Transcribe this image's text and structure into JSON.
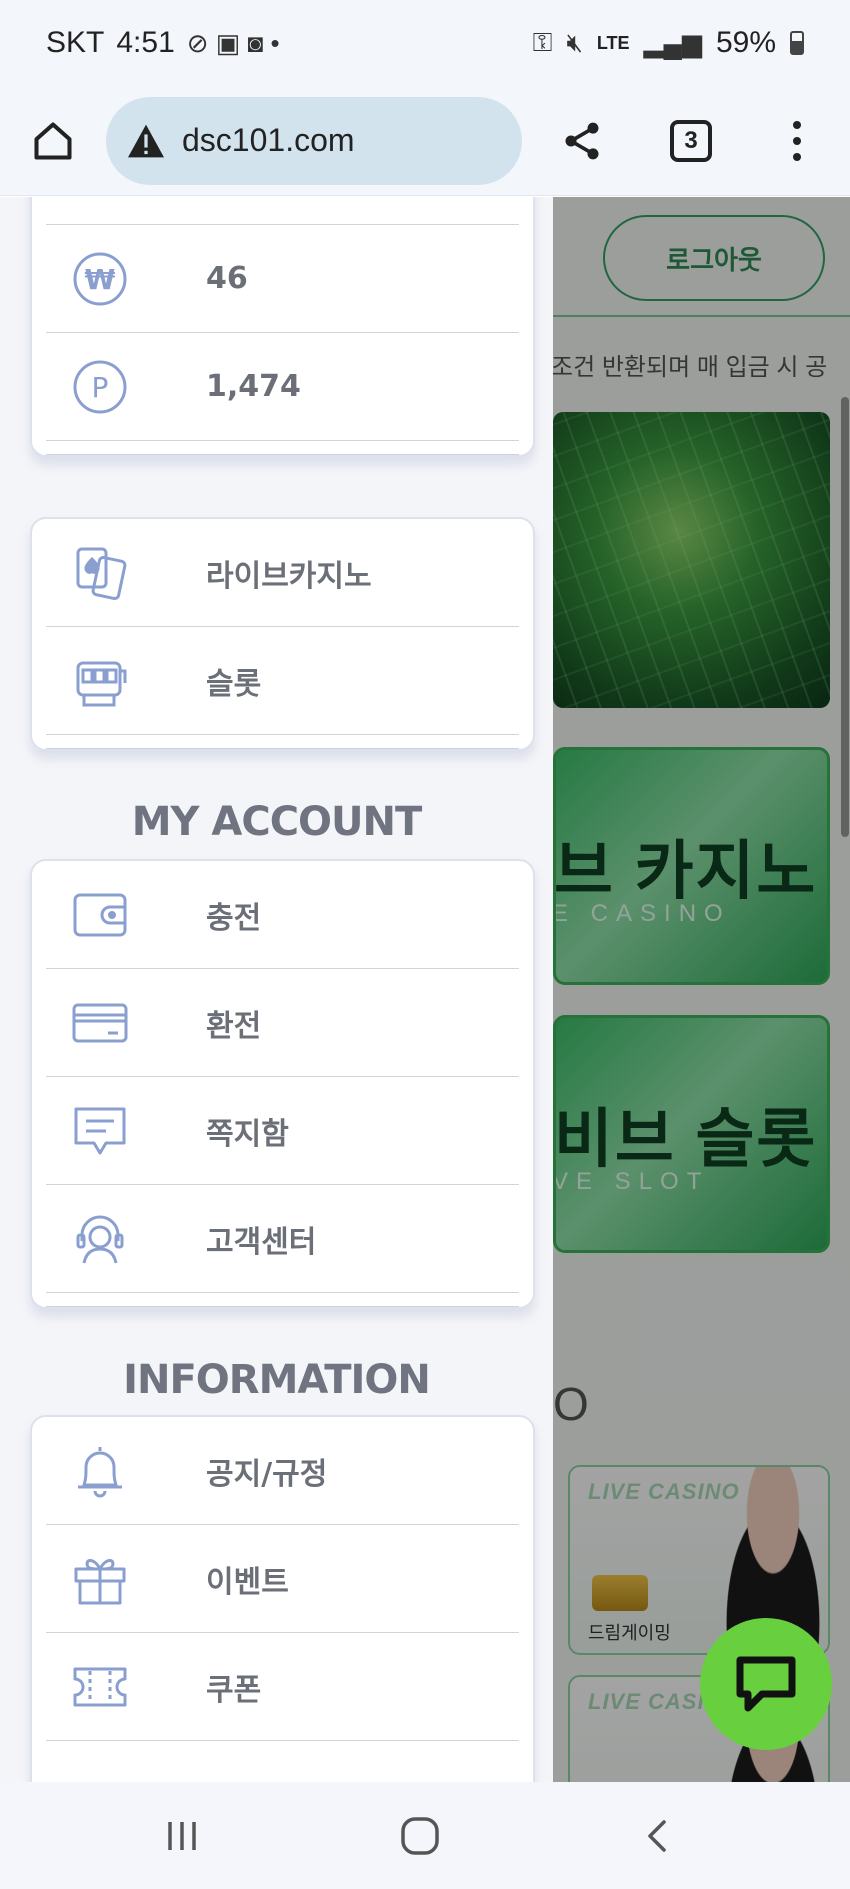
{
  "status_bar": {
    "carrier": "SKT",
    "time": "4:51",
    "network": "LTE",
    "battery": "59%"
  },
  "browser": {
    "url": "dsc101.com",
    "tab_count": "3"
  },
  "drawer": {
    "balance": {
      "cash_symbol": "₩",
      "cash": "46",
      "point_symbol": "P",
      "points": "1,474"
    },
    "games": [
      {
        "label": "라이브카지노",
        "icon": "cards-icon"
      },
      {
        "label": "슬롯",
        "icon": "slot-machine-icon"
      }
    ],
    "my_account": {
      "title": "MY ACCOUNT",
      "items": [
        {
          "label": "충전",
          "icon": "wallet-icon"
        },
        {
          "label": "환전",
          "icon": "card-icon"
        },
        {
          "label": "쪽지함",
          "icon": "message-icon"
        },
        {
          "label": "고객센터",
          "icon": "support-icon"
        }
      ]
    },
    "information": {
      "title": "INFORMATION",
      "items": [
        {
          "label": "공지/규정",
          "icon": "bell-icon"
        },
        {
          "label": "이벤트",
          "icon": "gift-icon"
        },
        {
          "label": "쿠폰",
          "icon": "ticket-icon"
        }
      ]
    }
  },
  "background_page": {
    "logout_label": "로그아웃",
    "notice": "조건 반환되며 매 입금 시 공",
    "banner_casino": {
      "title": "브 카지노",
      "subtitle": "E CASINO"
    },
    "banner_slot": {
      "title": "비브 슬롯",
      "subtitle": "VE SLOT"
    },
    "section_fragment": "O",
    "providers": [
      {
        "tag": "LIVE CASINO",
        "name": "드림게이밍"
      },
      {
        "tag": "LIVE CASI",
        "name": ""
      }
    ]
  },
  "colors": {
    "accent_green": "#35a065",
    "chat_fab": "#68d03f",
    "icon_blue": "#8a9fd0"
  }
}
